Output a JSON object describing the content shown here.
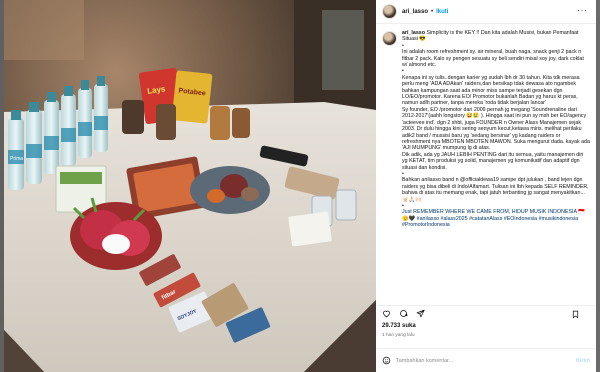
{
  "post": {
    "username": "ari_lasso",
    "follow_label": "Ikuti",
    "caption_lines": [
      "Simplicity is the KEY !! Dan kita adalah Musisi, bukan Pemanfaat Situasi 😎",
      "•",
      "Ini adalah room refreshment sy. air mineral, buah naga, snack genji 2 pack n fitbar 2 pack. Kalo sy pengen sesuatu sy beli sendiri misal soy joy, dark coklat w/ almond etc.",
      "•",
      "Kenapa ini sy tulis..dengan karier yg sudah lbh dr 30 tahun. Kita tdk merasa perlu meng 'ADA ADAkan' raiders,dan bersikap tdak dewasa ato ngambek bahkan kampungan saat ada minor miss sampe terjadi gesekan dgn LO/EO/promotor. Karena EO/ Promotor bukanlah Badan yg harus kt peras, namun adlh partner, tanpa mereka 'roda tidak berjalan lancar'",
      "Sy founder, EO /promotor dari 2009 pernah jg megang 'Soundrenaline dari 2012-2017'(aahh longstory 😅😢 ). Hingga saat ini pun sy msh ber EO/agency 'acteevee ind'. dgn 2 shbt, juga FOUNDER n Owner Alass Manajemen sejak 2003. Dr dulu hingga kini sering senyum kecut,ketawa miris. melihat perilaku adik2 band / mussisi baru yg 'sedang bersinar' yg kadang raiders or refreshment nya MBOTEN MBOTEN MAWON. Suka mengurut dada. kayak ada 'AJI MUMPUNG' mumpung lg di atas.",
      "Dik adik, ada yg JAUH LEBIH PENTING dari itu semua, yaitu manajemen diri yg KETAT, tim produksi yg solid, manajemen yg komunikatif dan adaptif dgn situasi dan kondisi.",
      "•",
      "Bahkan anilasso band n @officialdewa19 sampe dpt julukan , band lejen dgn raiders yg bisa dibeli di Indo/Alfamart. Tulisan ini lbh kepada SELF REMINDER, bahwa di atas itu memang enak, tapi jatuh terbanting jg sangat menyakitkan... 🤘🏻🙏🏻🙌🏻",
      "•",
      "Just REMEMBER WHERE WE CAME FROM, HIDUP MUSIK INDONESIA 🇮🇩 🫡🖤 #anilasso #alass2025 #catatanAlass #EOindonesia #musikindonesia #PromotorIndonesia"
    ],
    "likes": "29.733 suka",
    "time": "1 hari yang lalu",
    "comment_placeholder": "Tambahkan komentar...",
    "post_label": "Kirim"
  },
  "icons": {
    "more": "more-horizontal-icon",
    "like": "heart-icon",
    "comment": "comment-icon",
    "share": "paper-plane-icon",
    "save": "bookmark-icon",
    "emoji": "smiley-icon"
  },
  "photo": {
    "bottle_brand": "Prima",
    "snack_brand_1": "Potabee",
    "snack_brand_2": "Lays",
    "bar_brand": "fitbar",
    "bar_brand_2": "SOYJOY"
  },
  "colors": {
    "link": "#00376b",
    "accent": "#0095f6",
    "muted": "#737373"
  }
}
